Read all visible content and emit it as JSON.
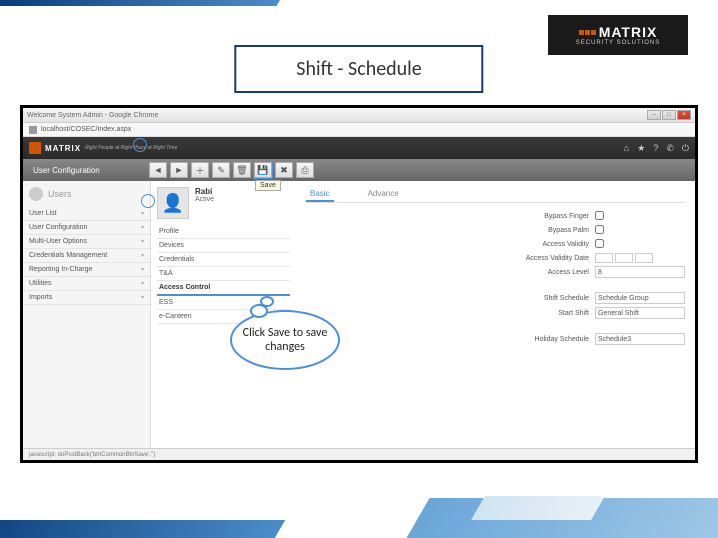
{
  "slide": {
    "title": "Shift - Schedule",
    "logo_main": "MATRIX",
    "logo_sub": "SECURITY SOLUTIONS"
  },
  "browser": {
    "window_title": "Welcome System Admin - Google Chrome",
    "url": "localhost/COSEC/Index.aspx",
    "status": "javascript:  doPostBack('btnCommonBtnSave','')"
  },
  "app": {
    "brand": "MATRIX",
    "tagline": "Right People at Right Place at Right Time",
    "toolbar_title": "User Configuration",
    "save_tooltip": "Save"
  },
  "sidebar": {
    "header": "Users",
    "items": [
      {
        "label": "User List"
      },
      {
        "label": "User Configuration"
      },
      {
        "label": "Multi-User Options"
      },
      {
        "label": "Credentials Management"
      },
      {
        "label": "Reporting In-Charge"
      },
      {
        "label": "Utilities"
      },
      {
        "label": "Imports"
      }
    ]
  },
  "user": {
    "name": "Rabi",
    "status": "Active"
  },
  "sections": [
    {
      "label": "Profile"
    },
    {
      "label": "Devices"
    },
    {
      "label": "Credentials"
    },
    {
      "label": "T&A"
    },
    {
      "label": "Access Control"
    },
    {
      "label": "ESS"
    },
    {
      "label": "e-Canteen"
    }
  ],
  "tabs": {
    "basic": "Basic",
    "advance": "Advance"
  },
  "form": {
    "bypass_finger": "Bypass Finger",
    "bypass_palm": "Bypass Palm",
    "access_validity": "Access Validity",
    "access_validity_date": "Access Validity Date",
    "access_level": "Access Level",
    "access_level_val": "8",
    "shift_schedule": "Shift Schedule",
    "shift_schedule_val": "Schedule Group",
    "start_shift": "Start Shift",
    "start_shift_val": "General Shift",
    "holiday_schedule": "Holiday Schedule",
    "holiday_schedule_val": "Schedule3"
  },
  "callout": "Click Save to save changes"
}
